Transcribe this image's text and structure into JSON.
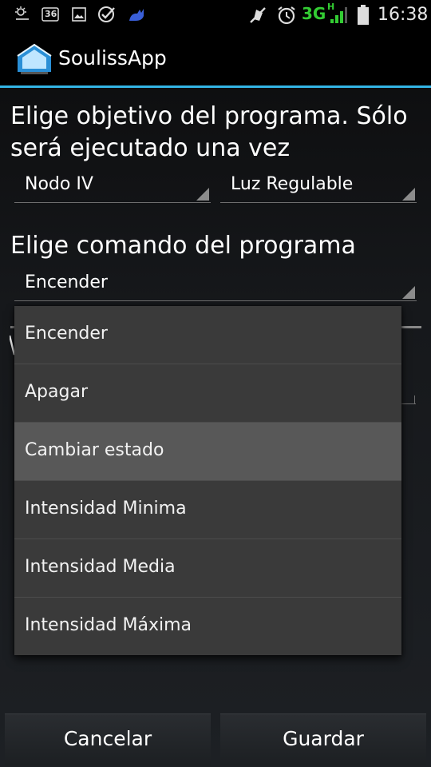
{
  "statusbar": {
    "network_type": "3G",
    "network_sub": "H",
    "time": "16:38",
    "icons": [
      "weather-icon",
      "badge-36-icon",
      "image-icon",
      "check-icon",
      "cat-icon",
      "mute-icon",
      "alarm-icon",
      "signal-icon",
      "battery-icon"
    ],
    "badge_text": "36"
  },
  "actionbar": {
    "title": "SoulissApp",
    "accent_color": "#33b5e5"
  },
  "form": {
    "target_heading": "Elige objetivo del programa. Sólo será ejecutado una vez",
    "node_value": "Nodo IV",
    "device_value": "Luz Regulable",
    "command_heading": "Elige comando del programa",
    "command_value": "Encender"
  },
  "dropdown": {
    "options": [
      {
        "label": "Encender",
        "selected": false
      },
      {
        "label": "Apagar",
        "selected": false
      },
      {
        "label": "Cambiar estado",
        "selected": true
      },
      {
        "label": "Intensidad Minima",
        "selected": false
      },
      {
        "label": "Intensidad Media",
        "selected": false
      },
      {
        "label": "Intensidad Máxima",
        "selected": false
      }
    ]
  },
  "buttons": {
    "cancel_label": "Cancelar",
    "save_label": "Guardar"
  }
}
